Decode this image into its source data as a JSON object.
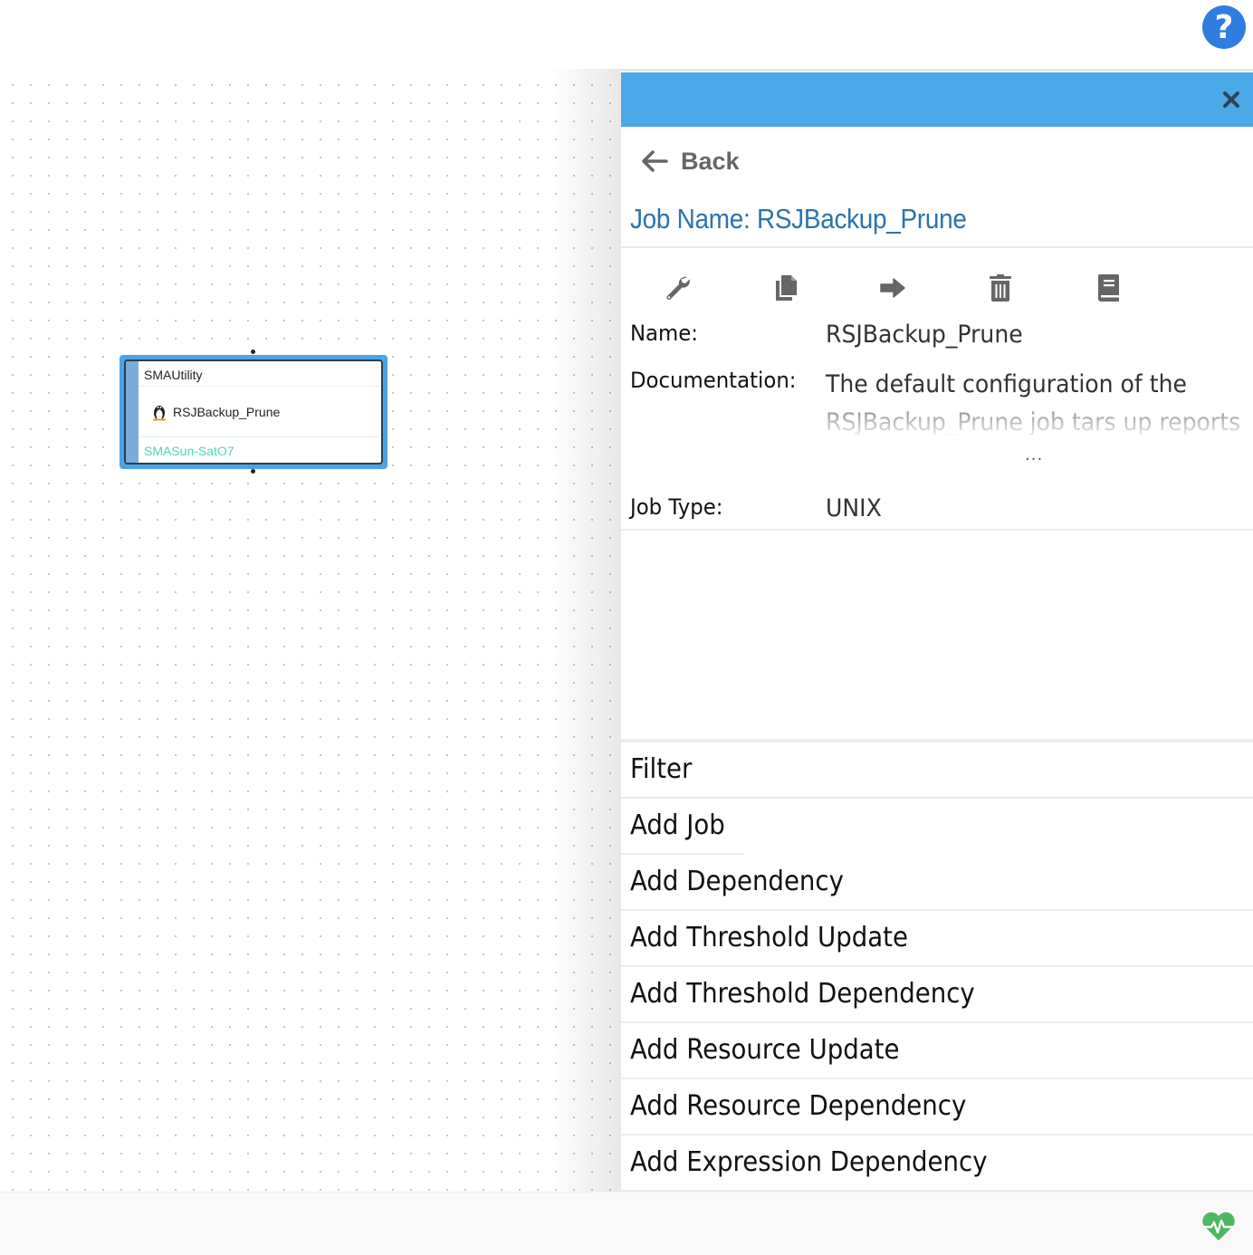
{
  "help": {
    "icon": "question-circle-icon",
    "glyph": "?"
  },
  "canvas": {
    "job_node": {
      "group": "SMAUtility",
      "name": "RSJBackup_Prune",
      "os_icon": "linux-tux-icon",
      "agent": "SMASun-SatO7",
      "selected": true
    }
  },
  "panel": {
    "close_glyph": "✕",
    "back_label": "Back",
    "title": "Job Name: RSJBackup_Prune",
    "toolbar": [
      {
        "name": "edit",
        "icon": "wrench-icon"
      },
      {
        "name": "copy",
        "icon": "copy-icon"
      },
      {
        "name": "move",
        "icon": "arrow-right-icon"
      },
      {
        "name": "delete",
        "icon": "trash-icon"
      },
      {
        "name": "documentation",
        "icon": "book-icon"
      }
    ],
    "fields": {
      "name_label": "Name:",
      "name_value": "RSJBackup_Prune",
      "doc_label": "Documentation:",
      "doc_value": "The default configuration of the RSJBackup_Prune job tars up reports old",
      "doc_more": "...",
      "type_label": "Job Type:",
      "type_value": "UNIX"
    },
    "menu": [
      "Filter",
      "Add Job",
      "Add Dependency",
      "Add Threshold Update",
      "Add Threshold Dependency",
      "Add Resource Update",
      "Add Resource Dependency",
      "Add Expression Dependency"
    ]
  },
  "footer": {
    "status_icon": "heartbeat-icon",
    "status_color": "#4cb862"
  },
  "colors": {
    "header": "#4aa9e6",
    "title": "#2b73b0",
    "help": "#2f7de1",
    "agent": "#4fd8a6"
  }
}
